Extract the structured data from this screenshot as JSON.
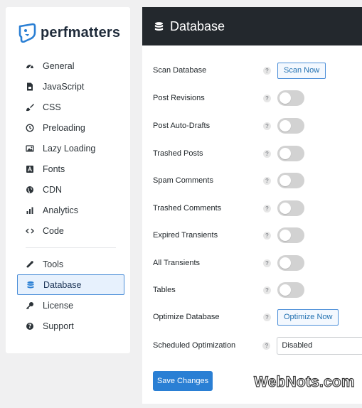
{
  "brand": {
    "name": "perfmatters",
    "accent": "#2a7fd4"
  },
  "sidebar": {
    "items": [
      {
        "label": "General",
        "icon": "gauge-icon"
      },
      {
        "label": "JavaScript",
        "icon": "file-js-icon"
      },
      {
        "label": "CSS",
        "icon": "brush-icon"
      },
      {
        "label": "Preloading",
        "icon": "clock-icon"
      },
      {
        "label": "Lazy Loading",
        "icon": "image-icon"
      },
      {
        "label": "Fonts",
        "icon": "font-icon"
      },
      {
        "label": "CDN",
        "icon": "globe-icon"
      },
      {
        "label": "Analytics",
        "icon": "bar-chart-icon"
      },
      {
        "label": "Code",
        "icon": "code-icon"
      }
    ],
    "secondary": [
      {
        "label": "Tools",
        "icon": "wrench-icon"
      },
      {
        "label": "Database",
        "icon": "database-icon",
        "active": true
      },
      {
        "label": "License",
        "icon": "key-icon"
      },
      {
        "label": "Support",
        "icon": "help-circle-icon"
      }
    ]
  },
  "panel": {
    "title": "Database",
    "rows": [
      {
        "label": "Scan Database",
        "control": "button",
        "button_label": "Scan Now"
      },
      {
        "label": "Post Revisions",
        "control": "toggle",
        "on": false
      },
      {
        "label": "Post Auto-Drafts",
        "control": "toggle",
        "on": false
      },
      {
        "label": "Trashed Posts",
        "control": "toggle",
        "on": false
      },
      {
        "label": "Spam Comments",
        "control": "toggle",
        "on": false
      },
      {
        "label": "Trashed Comments",
        "control": "toggle",
        "on": false
      },
      {
        "label": "Expired Transients",
        "control": "toggle",
        "on": false
      },
      {
        "label": "All Transients",
        "control": "toggle",
        "on": false
      },
      {
        "label": "Tables",
        "control": "toggle",
        "on": false
      },
      {
        "label": "Optimize Database",
        "control": "button",
        "button_label": "Optimize Now"
      },
      {
        "label": "Scheduled Optimization",
        "control": "select",
        "value": "Disabled"
      }
    ],
    "help_glyph": "?",
    "save_label": "Save Changes"
  },
  "watermark": "WebNots.com"
}
